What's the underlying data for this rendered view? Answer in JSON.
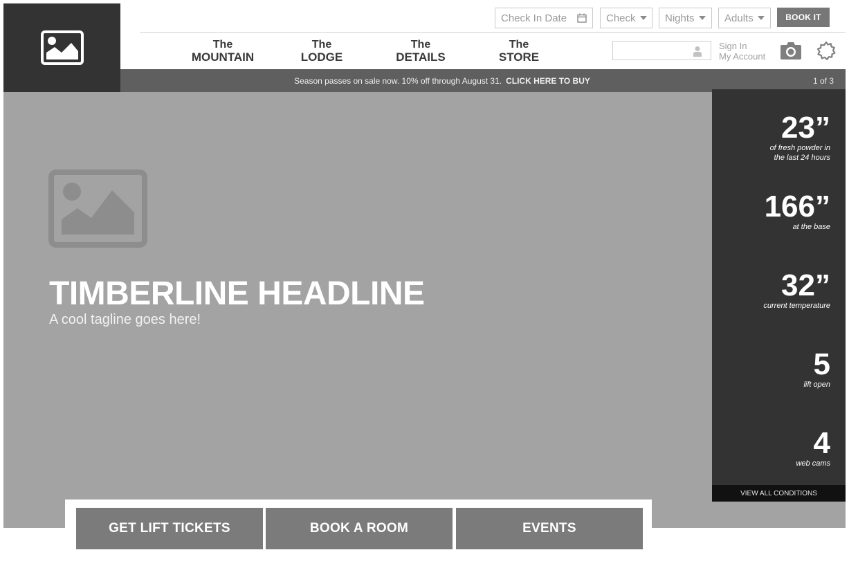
{
  "booking": {
    "check_in": "Check In Date",
    "check_out": "Check",
    "nights": "Nights",
    "adults": "Adults",
    "book_label": "BOOK IT"
  },
  "nav": [
    {
      "top": "The",
      "bottom": "MOUNTAIN"
    },
    {
      "top": "The",
      "bottom": "LODGE"
    },
    {
      "top": "The",
      "bottom": "DETAILS"
    },
    {
      "top": "The",
      "bottom": "STORE"
    }
  ],
  "account": {
    "sign_in": "Sign In",
    "my_account": "My Account"
  },
  "promo": {
    "text": "Season passes on sale now.  10% off through August 31.",
    "cta": "CLICK HERE TO BUY",
    "pager": "1 of 3"
  },
  "hero": {
    "headline": "TIMBERLINE HEADLINE",
    "tagline": "A cool tagline goes here!"
  },
  "conditions": {
    "stats": [
      {
        "value": "23”",
        "label_1": "of fresh powder in",
        "label_2": "the last 24 hours"
      },
      {
        "value": "166”",
        "label_1": "at the base",
        "label_2": ""
      },
      {
        "value": "32”",
        "label_1": "current temperature",
        "label_2": ""
      },
      {
        "value": "5",
        "label_1": "lift open",
        "label_2": ""
      },
      {
        "value": "4",
        "label_1": "web cams",
        "label_2": ""
      }
    ],
    "view_all": "VIEW ALL CONDITIONS"
  },
  "cta": {
    "lift_tickets": "GET LIFT TICKETS",
    "book_room": "BOOK A ROOM",
    "events": "EVENTS"
  },
  "colors": {
    "dark": "#333333",
    "hero": "#a3a3a3",
    "promo": "#5f5f5f",
    "button": "#7b7b7b"
  }
}
